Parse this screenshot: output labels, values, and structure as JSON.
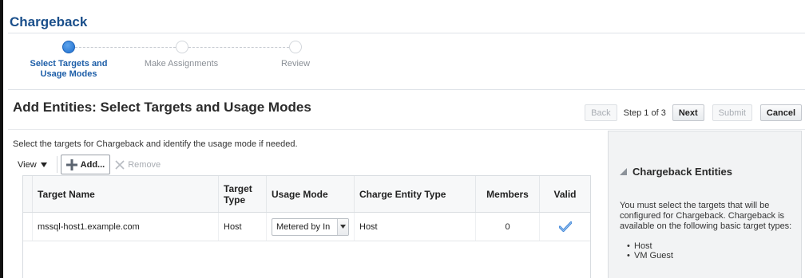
{
  "app": {
    "title": "Chargeback"
  },
  "train": {
    "steps": [
      {
        "label_line1": "Select Targets and",
        "label_line2": "Usage Modes",
        "state": "active"
      },
      {
        "label_line1": "Make Assignments",
        "label_line2": "",
        "state": "inactive"
      },
      {
        "label_line1": "Review",
        "label_line2": "",
        "state": "inactive"
      }
    ]
  },
  "page": {
    "title": "Add Entities: Select Targets and Usage Modes",
    "instructions": "Select the targets for Chargeback and identify the usage mode if needed."
  },
  "nav": {
    "back_label": "Back",
    "step_text": "Step 1 of 3",
    "next_label": "Next",
    "submit_label": "Submit",
    "cancel_label": "Cancel"
  },
  "toolbar": {
    "view_label": "View",
    "add_label": "Add...",
    "remove_label": "Remove"
  },
  "table": {
    "headers": {
      "target_name": "Target Name",
      "target_type_1": "Target",
      "target_type_2": "Type",
      "usage_mode": "Usage Mode",
      "charge_entity_type": "Charge Entity Type",
      "members": "Members",
      "valid": "Valid"
    },
    "rows": [
      {
        "target_name": "mssql-host1.example.com",
        "target_type": "Host",
        "usage_mode": "Metered by In",
        "charge_entity_type": "Host",
        "members": "0",
        "valid_icon": "checkmark-icon"
      }
    ]
  },
  "panel": {
    "title": "Chargeback Entities",
    "body": "You must select the targets that will be configured for Chargeback. Chargeback is available on the following basic target types:",
    "items": [
      "Host",
      "VM Guest"
    ]
  },
  "colors": {
    "brand_title": "#1a4f8b",
    "active_step": "#1f6fce",
    "check": "#3b82d6"
  }
}
